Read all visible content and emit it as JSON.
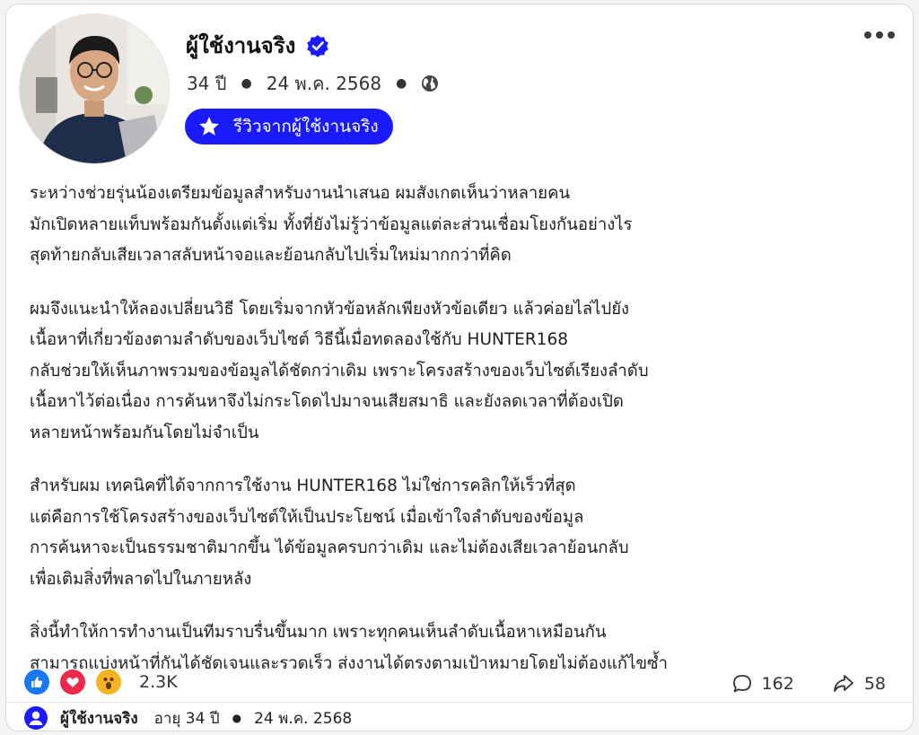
{
  "post": {
    "author_name": "ผู้ใช้งานจริง",
    "age": "34 ปี",
    "date": "24 พ.ค. 2568",
    "review_badge": "รีวิวจากผู้ใช้งานจริง",
    "paragraphs": [
      "ระหว่างช่วยรุ่นน้องเตรียมข้อมูลสำหรับงานนำเสนอ ผมสังเกตเห็นว่าหลายคน\nมักเปิดหลายแท็บพร้อมกันตั้งแต่เริ่ม ทั้งที่ยังไม่รู้ว่าข้อมูลแต่ละส่วนเชื่อมโยงกันอย่างไร\nสุดท้ายกลับเสียเวลาสลับหน้าจอและย้อนกลับไปเริ่มใหม่มากกว่าที่คิด",
      "ผมจึงแนะนำให้ลองเปลี่ยนวิธี โดยเริ่มจากหัวข้อหลักเพียงหัวข้อเดียว แล้วค่อยไล่ไปยัง\nเนื้อหาที่เกี่ยวข้องตามลำดับของเว็บไซต์ วิธีนี้เมื่อทดลองใช้กับ HUNTER168\nกลับช่วยให้เห็นภาพรวมของข้อมูลได้ชัดกว่าเดิม เพราะโครงสร้างของเว็บไซต์เรียงลำดับ\nเนื้อหาไว้ต่อเนื่อง การค้นหาจึงไม่กระโดดไปมาจนเสียสมาธิ และยังลดเวลาที่ต้องเปิด\nหลายหน้าพร้อมกันโดยไม่จำเป็น",
      "สำหรับผม เทคนิคที่ได้จากการใช้งาน HUNTER168 ไม่ใช่การคลิกให้เร็วที่สุด\nแต่คือการใช้โครงสร้างของเว็บไซต์ให้เป็นประโยชน์ เมื่อเข้าใจลำดับของข้อมูล\nการค้นหาจะเป็นธรรมชาติมากขึ้น ได้ข้อมูลครบกว่าเดิม และไม่ต้องเสียเวลาย้อนกลับ\nเพื่อเติมสิ่งที่พลาดไปในภายหลัง",
      "สิ่งนี้ทำให้การทำงานเป็นทีมราบรื่นขึ้นมาก เพราะทุกคนเห็นลำดับเนื้อหาเหมือนกัน\nสามารถแบ่งหน้าที่กันได้ชัดเจนและรวดเร็ว ส่งงานได้ตรงตามเป้าหมายโดยไม่ต้องแก้ไขซ้ำ"
    ]
  },
  "engagement": {
    "reaction_count": "2.3K",
    "comments": "162",
    "shares": "58",
    "reactions": [
      "like-icon",
      "love-icon",
      "wow-icon"
    ]
  },
  "footer": {
    "name": "ผู้ใช้งานจริง",
    "age_label": "อายุ 34 ปี",
    "date": "24 พ.ค. 2568"
  },
  "colors": {
    "accent": "#1a1aff",
    "like": "#1877f2",
    "love": "#f02849",
    "wow": "#f7b125"
  }
}
